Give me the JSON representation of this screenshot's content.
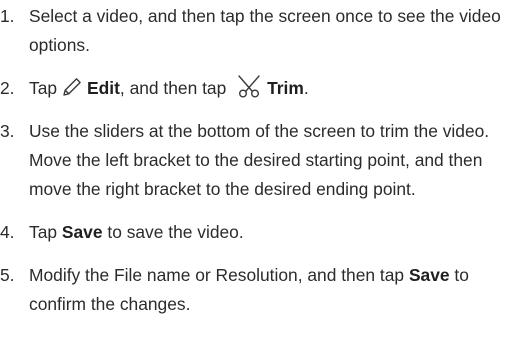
{
  "steps": [
    {
      "number": "1.",
      "text": "Select a video, and then tap the screen once to see the video options."
    },
    {
      "number": "2.",
      "pre_edit": "Tap",
      "edit_icon": "pencil-icon",
      "edit_label": "Edit",
      "mid": ", and then tap",
      "trim_icon": "scissors-icon",
      "trim_label": "Trim",
      "end": "."
    },
    {
      "number": "3.",
      "text": "Use the sliders at the bottom of the screen to trim the video. Move the left bracket to the desired starting point, and then move the right bracket to the desired ending point."
    },
    {
      "number": "4.",
      "pre": "Tap",
      "bold": "Save",
      "post": "to save the video."
    },
    {
      "number": "5.",
      "pre": "Modify the File name or Resolution, and then tap",
      "bold": "Save",
      "post": "to confirm the changes."
    }
  ],
  "colors": {
    "text": "#2b2b2b",
    "icon_stroke": "#3a3a3a"
  }
}
